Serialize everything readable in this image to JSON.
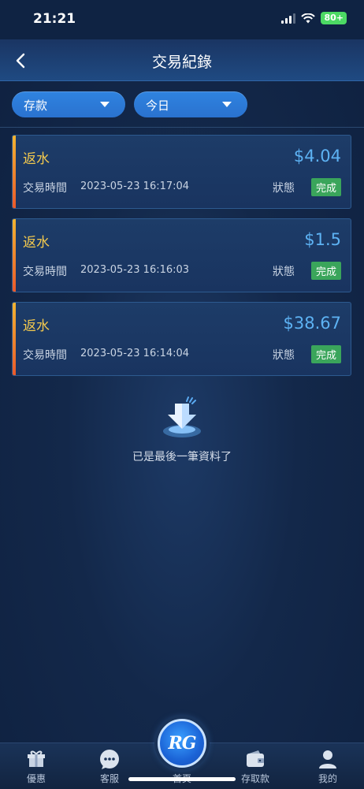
{
  "status_bar": {
    "time": "21:21",
    "battery": "80+"
  },
  "header": {
    "title": "交易紀錄"
  },
  "filters": {
    "type": "存款",
    "period": "今日"
  },
  "records": [
    {
      "type": "返水",
      "amount": "$4.04",
      "time_label": "交易時間",
      "time": "2023-05-23 16:17:04",
      "status_label": "狀態",
      "status": "完成"
    },
    {
      "type": "返水",
      "amount": "$1.5",
      "time_label": "交易時間",
      "time": "2023-05-23 16:16:03",
      "status_label": "狀態",
      "status": "完成"
    },
    {
      "type": "返水",
      "amount": "$38.67",
      "time_label": "交易時間",
      "time": "2023-05-23 16:14:04",
      "status_label": "狀態",
      "status": "完成"
    }
  ],
  "end_message": "已是最後一筆資料了",
  "tabbar": {
    "items": [
      {
        "label": "優惠",
        "icon": "gift-icon"
      },
      {
        "label": "客服",
        "icon": "chat-icon"
      },
      {
        "label": "首頁",
        "icon": "rg-logo"
      },
      {
        "label": "存取款",
        "icon": "wallet-icon"
      },
      {
        "label": "我的",
        "icon": "user-icon"
      }
    ],
    "logo_text": "RG"
  },
  "colors": {
    "accent": "#2f83e0",
    "amount": "#5db2f3",
    "type": "#f3c94e",
    "status_ok": "#3aa55b"
  }
}
